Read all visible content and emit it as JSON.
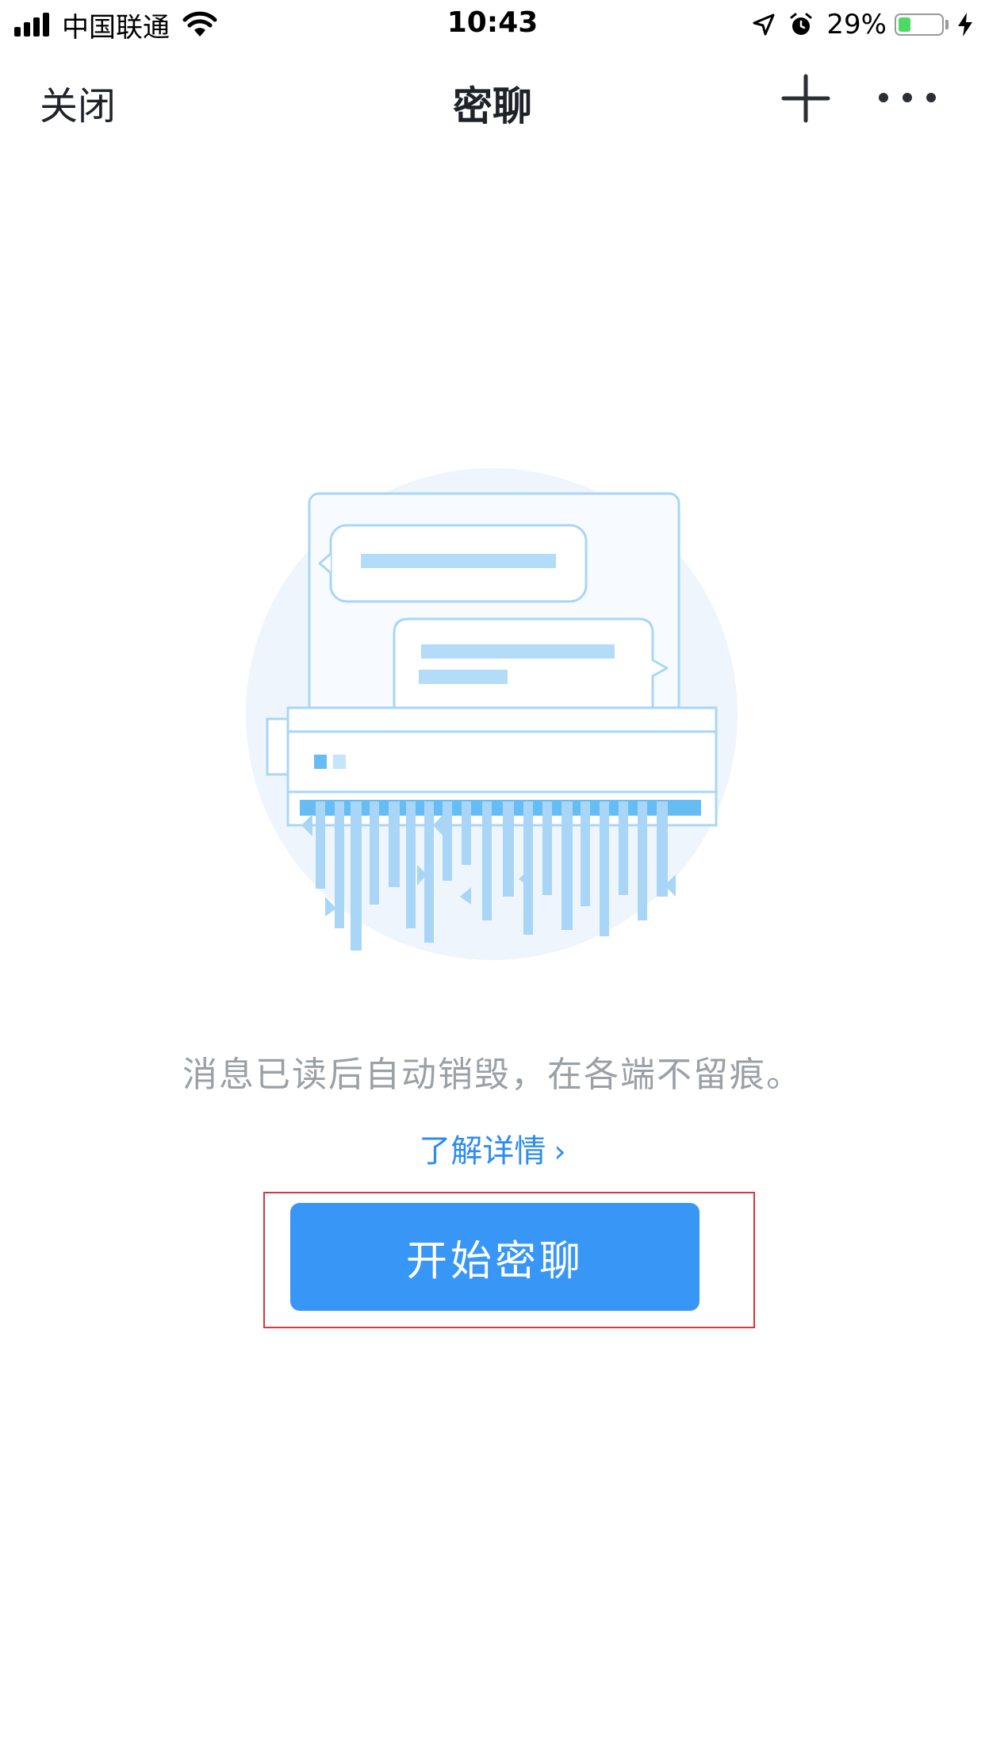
{
  "status_bar": {
    "carrier": "中国联通",
    "time": "10:43",
    "battery_percent": "29%",
    "battery_level": 0.29,
    "icons": [
      "signal-icon",
      "wifi-icon",
      "location-icon",
      "alarm-icon",
      "battery-icon",
      "charging-icon"
    ]
  },
  "nav": {
    "close_label": "关闭",
    "title": "密聊",
    "add_icon": "plus-icon",
    "more_icon": "more-icon"
  },
  "main": {
    "illustration": "shredder-illustration",
    "description": "消息已读后自动销毁，在各端不留痕。",
    "learn_more": "了解详情",
    "learn_more_chevron": "›",
    "start_button": "开始密聊"
  },
  "colors": {
    "accent": "#3896f7",
    "link": "#2d8cf0",
    "highlight": "#d9363e",
    "illustration_light": "#b3dcf8",
    "illustration_mid": "#6ec0f5"
  }
}
